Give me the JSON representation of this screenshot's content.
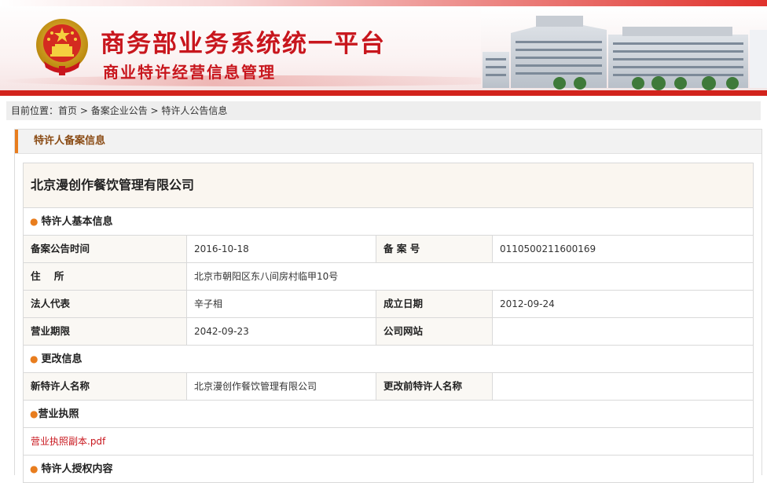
{
  "header": {
    "title_main": "商务部业务系统统一平台",
    "title_sub": "商业特许经营信息管理"
  },
  "breadcrumb": {
    "prefix": "目前位置：",
    "items": [
      "首页",
      "备案企业公告",
      "特许人公告信息"
    ],
    "separator": " > "
  },
  "panel": {
    "title": "特许人备案信息",
    "company_name": "北京漫创作餐饮管理有限公司",
    "basic_section": "特许人基本信息",
    "basic": {
      "announce_time_label": "备案公告时间",
      "announce_time_value": "2016-10-18",
      "record_no_label": "备 案 号",
      "record_no_value": "0110500211600169",
      "address_label": "住    所",
      "address_value": "北京市朝阳区东八间房村临甲10号",
      "legal_rep_label": "法人代表",
      "legal_rep_value": "辛子相",
      "found_date_label": "成立日期",
      "found_date_value": "2012-09-24",
      "term_label": "营业期限",
      "term_value": "2042-09-23",
      "website_label": "公司网站",
      "website_value": ""
    },
    "change_section": "更改信息",
    "change": {
      "new_name_label": "新特许人名称",
      "new_name_value": "北京漫创作餐饮管理有限公司",
      "old_name_label": "更改前特许人名称",
      "old_name_value": ""
    },
    "license_section": "营业执照",
    "license_link": "营业执照副本.pdf",
    "auth_section": "特许人授权内容"
  },
  "colors": {
    "brand_red": "#c8161d",
    "accent_orange": "#e87d1e"
  }
}
